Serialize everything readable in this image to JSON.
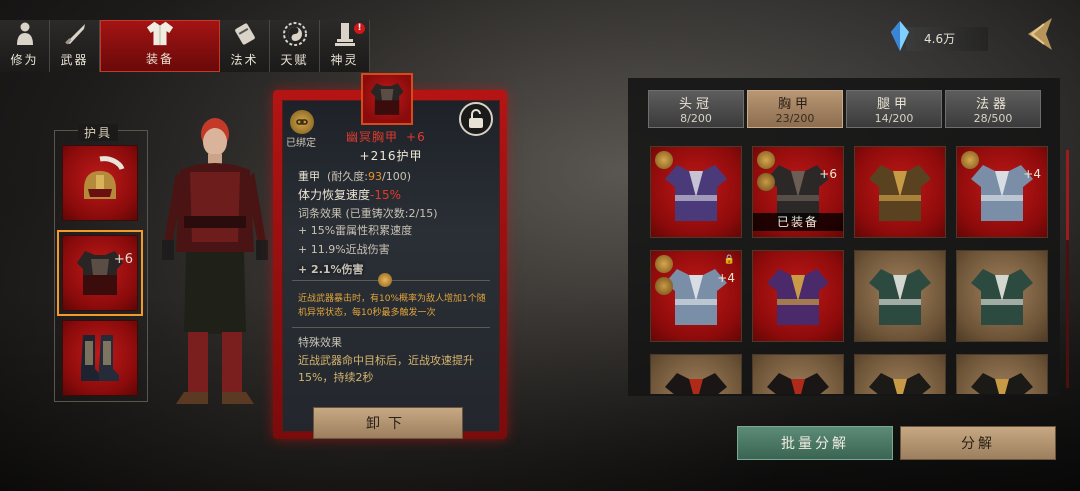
{
  "tabs": [
    {
      "label": "修为",
      "icon": "meditation-figure-icon"
    },
    {
      "label": "武器",
      "icon": "weapon-icon"
    },
    {
      "label": "装备",
      "icon": "robe-icon",
      "active": true
    },
    {
      "label": "法术",
      "icon": "scroll-icon"
    },
    {
      "label": "天赋",
      "icon": "yin-yang-icon"
    },
    {
      "label": "神灵",
      "icon": "shrine-icon",
      "badge": "!"
    }
  ],
  "slots": {
    "title": "护具",
    "items": [
      {
        "name": "helmet",
        "plus": ""
      },
      {
        "name": "chest-armor",
        "plus": "+6",
        "selected": true
      },
      {
        "name": "boots",
        "plus": ""
      }
    ]
  },
  "tooltip": {
    "bound_label": "已绑定",
    "item_name": "幽冥胸甲",
    "item_plus": "+6",
    "armor": "+216护甲",
    "type": "重甲",
    "durability_label": "(耐久度:",
    "durability_cur": "93",
    "durability_max": "/100)",
    "stamina_label": "体力恢复速度",
    "stamina_value": "-15%",
    "affix_header": "词条效果 (已重铸次数:2/15)",
    "affixes": [
      "+ 15%雷属性积累速度",
      "+ 11.9%近战伤害",
      "+ 2.1%伤害"
    ],
    "gem_desc": "近战武器暴击时，有10%概率为敌人增加1个随机异常状态，每10秒最多触发一次",
    "special_header": "特殊效果",
    "special_desc": "近战武器命中目标后，近战攻速提升15%，持续2秒",
    "unequip_label": "卸下"
  },
  "currency": {
    "amount": "4.6万"
  },
  "inventory": {
    "categories": [
      {
        "name": "头冠",
        "count": "8/200"
      },
      {
        "name": "胸甲",
        "count": "23/200",
        "active": true
      },
      {
        "name": "腿甲",
        "count": "14/200"
      },
      {
        "name": "法器",
        "count": "28/500"
      }
    ],
    "equipped_label": "已装备",
    "items": [
      {
        "bg": "red",
        "badge1": true,
        "badge2": false,
        "plus": "",
        "lock": false,
        "equipped": false,
        "style": "purple-robe"
      },
      {
        "bg": "red",
        "badge1": true,
        "badge2": true,
        "plus": "+6",
        "lock": false,
        "equipped": true,
        "style": "dark-armor"
      },
      {
        "bg": "red",
        "badge1": false,
        "badge2": false,
        "plus": "",
        "lock": false,
        "equipped": false,
        "style": "gold-armor"
      },
      {
        "bg": "red",
        "badge1": true,
        "badge2": false,
        "plus": "+4",
        "lock": false,
        "equipped": false,
        "style": "blue-robe"
      },
      {
        "bg": "red",
        "badge1": true,
        "badge2": true,
        "plus": "+4",
        "lock": true,
        "equipped": false,
        "style": "blue-robe"
      },
      {
        "bg": "red",
        "badge1": false,
        "badge2": false,
        "plus": "",
        "lock": false,
        "equipped": false,
        "style": "purple-armor"
      },
      {
        "bg": "gold",
        "badge1": false,
        "badge2": false,
        "plus": "",
        "lock": false,
        "equipped": false,
        "style": "green-robe"
      },
      {
        "bg": "gold",
        "badge1": false,
        "badge2": false,
        "plus": "",
        "lock": false,
        "equipped": false,
        "style": "green-robe"
      },
      {
        "bg": "gold",
        "badge1": false,
        "badge2": false,
        "plus": "",
        "lock": false,
        "equipped": false,
        "style": "black-red-robe"
      },
      {
        "bg": "gold",
        "badge1": false,
        "badge2": false,
        "plus": "",
        "lock": false,
        "equipped": false,
        "style": "black-red-robe"
      },
      {
        "bg": "gold",
        "badge1": false,
        "badge2": false,
        "plus": "",
        "lock": false,
        "equipped": false,
        "style": "black-gold-armor"
      },
      {
        "bg": "gold",
        "badge1": false,
        "badge2": false,
        "plus": "",
        "lock": false,
        "equipped": false,
        "style": "black-gold-armor"
      }
    ]
  },
  "buttons": {
    "bulk_disassemble": "批量分解",
    "disassemble": "分解"
  },
  "colors": {
    "accent_red": "#b51414",
    "gold": "#c7a883",
    "green": "#4f7d69"
  }
}
